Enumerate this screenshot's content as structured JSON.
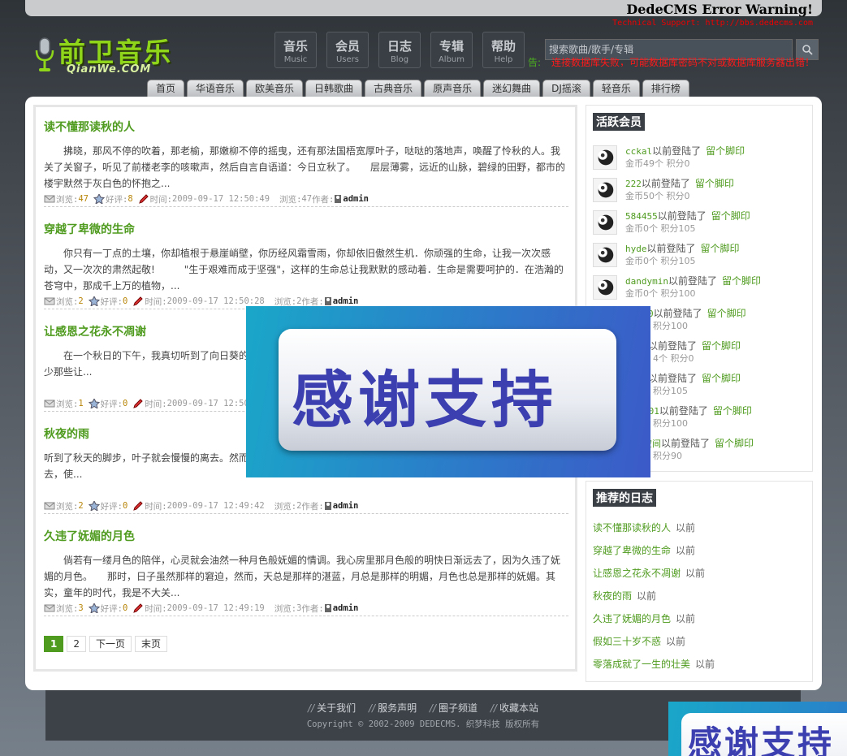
{
  "error": {
    "title": "DedeCMS Error Warning!",
    "support": "Technical Support: http://bbs.dedecms.com"
  },
  "logo": {
    "text": "前卫音乐",
    "sub": "QianWe.COM"
  },
  "main_nav": [
    {
      "zh": "音乐",
      "en": "Music"
    },
    {
      "zh": "会员",
      "en": "Users"
    },
    {
      "zh": "日志",
      "en": "Blog"
    },
    {
      "zh": "专辑",
      "en": "Album"
    },
    {
      "zh": "帮助",
      "en": "Help"
    }
  ],
  "search": {
    "placeholder": "搜索歌曲/歌手/专辑"
  },
  "notice": {
    "label": "告:",
    "text": "连接数据库失败，可能数据库密码不对或数据库服务器出错！"
  },
  "categories": [
    "首页",
    "华语音乐",
    "欧美音乐",
    "日韩歌曲",
    "古典音乐",
    "原声音乐",
    "迷幻舞曲",
    "DJ摇滚",
    "轻音乐",
    "排行榜"
  ],
  "articles": [
    {
      "title": "读不懂那读秋的人",
      "body": "　　拂晓，那风不停的吹着，那老榆，那嫩柳不停的摇曳，还有那法国梧宽厚叶子，哒哒的落地声，唤醒了怜秋的人。我关了关窗子，听见了前楼老李的咳嗽声，然后自言自语道：今日立秋了。　　层层薄雾，远近的山脉，碧绿的田野，都市的楼宇默然于灰白色的怀抱之...",
      "views": "47",
      "likes": "8",
      "time": "2009-09-17 12:50:49",
      "browse": "47",
      "author": "admin"
    },
    {
      "title": "穿越了卑微的生命",
      "body": "　　你只有一丁点的土壤，你却植根于悬崖峭壁，你历经风霜雪雨，你却依旧傲然生机．你顽强的生命，让我一次次感动，又一次次的肃然起敬!　　　\"生于艰难而成于坚强\"，这样的生命总让我默默的感动着．生命是需要呵护的．在浩瀚的苍穹中，那成千上万的植物，...",
      "views": "2",
      "likes": "0",
      "time": "2009-09-17 12:50:28",
      "browse": "2",
      "author": "admin"
    },
    {
      "title": "让感恩之花永不凋谢",
      "body": "　　在一个秋日的下午，我真切听到了向日葵的声音，是的，无论任何一个时代，人们的本性是善良的，们身边，并不缺少那些让...",
      "views": "1",
      "likes": "0",
      "time": "2009-09-17 12:50:05",
      "browse": "1",
      "author": "admin"
    },
    {
      "title": "秋夜的雨",
      "body": "听到了秋天的脚步，叶子就会慢慢的离去。然而时轮回中最具魅力的风景。有人说，落叶是秋的丰腴和静美。　叶子的离去，使...",
      "views": "2",
      "likes": "0",
      "time": "2009-09-17 12:49:42",
      "browse": "2",
      "author": "admin"
    },
    {
      "title": "久违了妩媚的月色",
      "body": "　　倘若有一缕月色的陪伴，心灵就会油然一种月色般妩媚的情调。我心房里那月色般的明快日渐远去了，因为久违了妩媚的月色。　　那时，日子虽然那样的窘迫，然而，天总是那样的湛蓝，月总是那样的明媚，月色也总是那样的妩媚。其实，童年的时代，我是不大关...",
      "views": "3",
      "likes": "0",
      "time": "2009-09-17 12:49:19",
      "browse": "3",
      "author": "admin"
    }
  ],
  "meta_labels": {
    "views": "浏览:",
    "likes": "好评:",
    "time": "时间:",
    "browse": "浏览:",
    "author": "作者:"
  },
  "pager": {
    "p1": "1",
    "p2": "2",
    "next": "下一页",
    "last": "末页"
  },
  "active_members": {
    "title": "活跃会员",
    "login_suffix": "以前登陆了",
    "footprint": "留个脚印",
    "items": [
      {
        "name": "cckal",
        "coins": "金币49个",
        "points": "积分0"
      },
      {
        "name": "222",
        "coins": "金币50个",
        "points": "积分0"
      },
      {
        "name": "584455",
        "coins": "金币0个",
        "points": "积分105"
      },
      {
        "name": "hyde",
        "coins": "金币0个",
        "points": "积分105"
      },
      {
        "name": "dandymin",
        "coins": "金币0个",
        "points": "积分100"
      },
      {
        "name": "0",
        "coins": "",
        "points": "积分100"
      },
      {
        "name": "",
        "coins": "4个",
        "points": "积分0"
      },
      {
        "name": "",
        "coins": "",
        "points": "积分105"
      },
      {
        "name": "101",
        "coins": "",
        "points": "积分100"
      },
      {
        "name": "空间",
        "coins": "",
        "points": "积分90"
      }
    ]
  },
  "recommended": {
    "title": "推荐的日志",
    "ago": "以前",
    "items": [
      "读不懂那读秋的人",
      "穿越了卑微的生命",
      "让感恩之花永不凋谢",
      "秋夜的雨",
      "久违了妩媚的月色",
      "假如三十岁不惑",
      "零落成就了一生的壮美"
    ]
  },
  "banner": {
    "text": "感谢支持"
  },
  "footer": {
    "links": [
      "关于我们",
      "服务声明",
      "圈子频道",
      "收藏本站"
    ],
    "copyright": "Copyright © 2002-2009 DEDECMS. 织梦科技 版权所有"
  },
  "colors": {
    "accent": "#4f9b1f",
    "logo": "#8fd61a",
    "error": "#ff1a1a",
    "banner": "#3c3fb0"
  }
}
